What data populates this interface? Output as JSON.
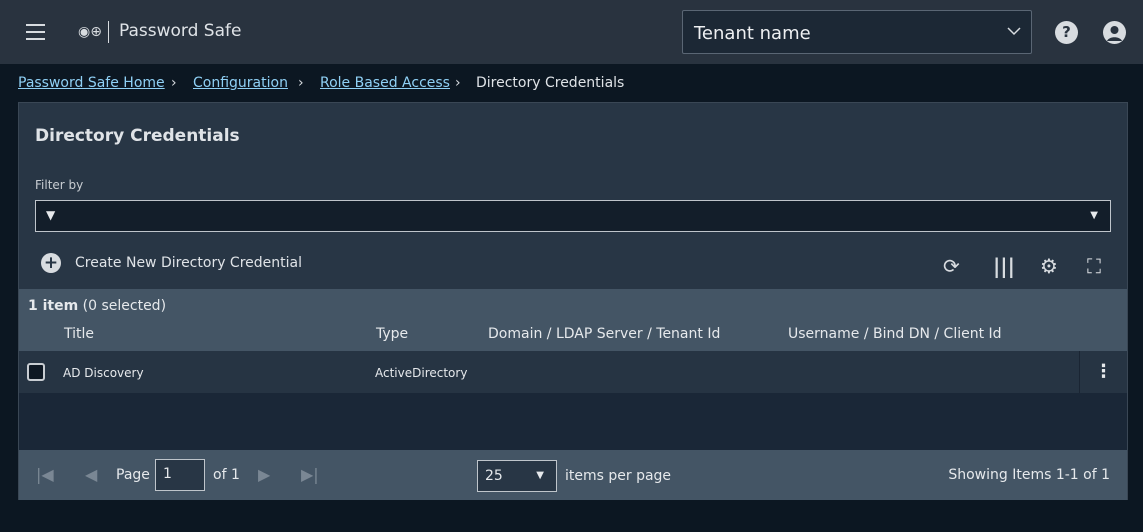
{
  "header": {
    "app_title": "Password Safe",
    "tenant": "Tenant name",
    "help": "?"
  },
  "breadcrumb": [
    "Password Safe Home",
    "Configuration",
    "Role Based Access",
    "Directory Credentials"
  ],
  "panel": {
    "title": "Directory Credentials",
    "filter_label": "Filter by",
    "create_label": "Create New Directory Credential"
  },
  "table": {
    "count_bold": "1 item",
    "count_rest": " (0 selected)",
    "columns": [
      "Title",
      "Type",
      "Domain / LDAP Server / Tenant Id",
      "Username / Bind DN / Client Id"
    ],
    "rows": [
      {
        "title": "AD Discovery",
        "type": "ActiveDirectory",
        "domain": "",
        "username": ""
      }
    ]
  },
  "footer": {
    "page_label": "Page",
    "page": "1",
    "of": "of 1",
    "per_page": "25",
    "per_page_label": "items per page",
    "showing": "Showing Items 1-1 of 1"
  }
}
